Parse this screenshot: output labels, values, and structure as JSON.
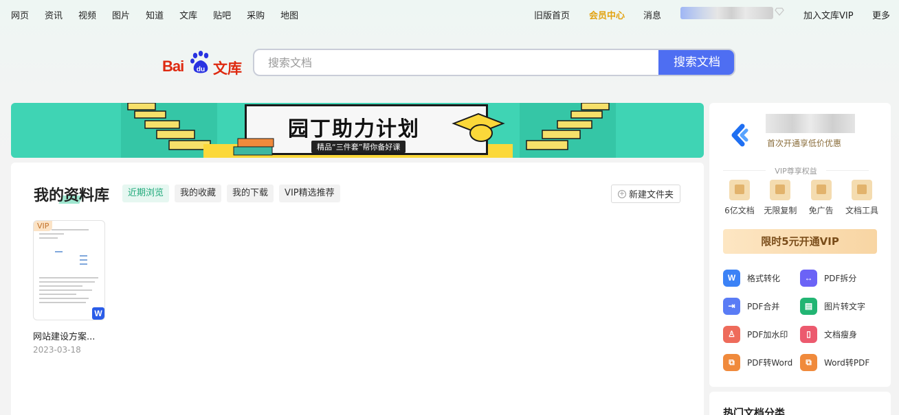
{
  "topnav": {
    "left_items": [
      "网页",
      "资讯",
      "视频",
      "图片",
      "知道",
      "文库",
      "贴吧",
      "采购",
      "地图"
    ],
    "old_home": "旧版首页",
    "vip_center": "会员中心",
    "messages": "消息",
    "join_vip": "加入文库VIP",
    "more": "更多"
  },
  "logo": {
    "bai": "Bai",
    "du": "du",
    "wenku": "文库"
  },
  "search": {
    "placeholder": "搜索文档",
    "button": "搜索文档"
  },
  "banner": {
    "title": "园丁助力计划",
    "subtitle": "精品“三件套”帮你备好课"
  },
  "library": {
    "title": "我的资料库",
    "tabs": [
      "近期浏览",
      "我的收藏",
      "我的下载",
      "VIP精选推荐"
    ],
    "active_tab": "近期浏览",
    "new_folder": "新建文件夹",
    "docs": [
      {
        "badge": "VIP",
        "name": "网站建设方案...",
        "date": "2023-03-18",
        "type": "W"
      }
    ]
  },
  "sidebar": {
    "offer": "首次开通享低价优惠",
    "vip_rights": "VIP尊享权益",
    "perks": [
      "6亿文档",
      "无限复制",
      "免广告",
      "文档工具"
    ],
    "vip_button": "限时5元开通VIP",
    "tools": [
      {
        "label": "格式转化",
        "icon": "format-convert-icon",
        "color": "#3b82f6"
      },
      {
        "label": "PDF拆分",
        "icon": "pdf-split-icon",
        "color": "#6b63f6"
      },
      {
        "label": "PDF合并",
        "icon": "pdf-merge-icon",
        "color": "#5a7cf5"
      },
      {
        "label": "图片转文字",
        "icon": "image-to-text-icon",
        "color": "#22b573"
      },
      {
        "label": "PDF加水印",
        "icon": "pdf-watermark-icon",
        "color": "#ee6b5b"
      },
      {
        "label": "文档瘦身",
        "icon": "doc-compress-icon",
        "color": "#ec5a6e"
      },
      {
        "label": "PDF转Word",
        "icon": "pdf-to-word-icon",
        "color": "#f08a3c"
      },
      {
        "label": "Word转PDF",
        "icon": "word-to-pdf-icon",
        "color": "#f08a3c"
      }
    ]
  },
  "hot_categories": {
    "title": "热门文档分类"
  }
}
